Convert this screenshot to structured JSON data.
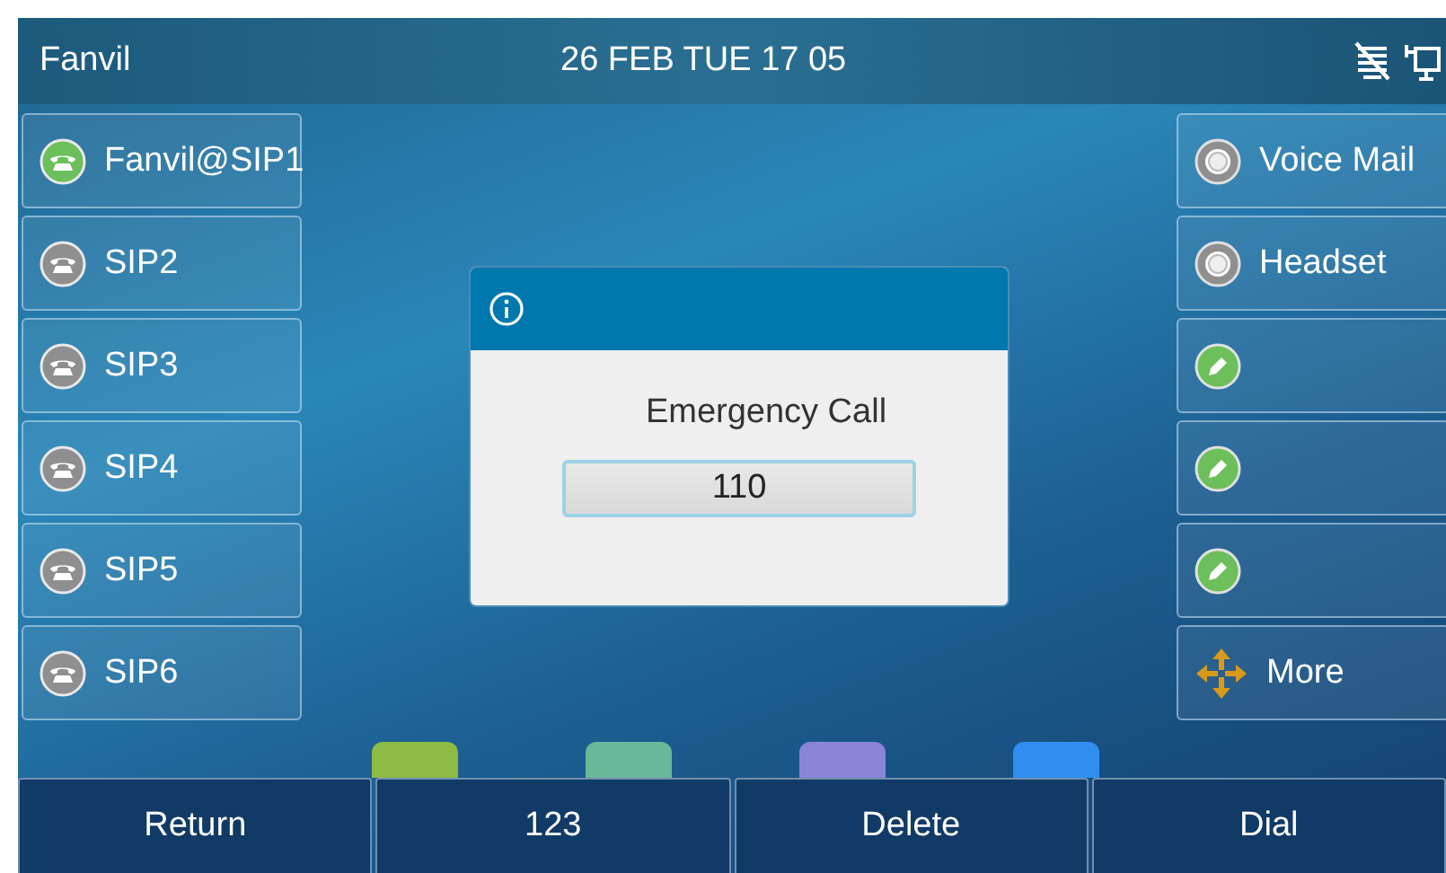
{
  "status_bar": {
    "title": "Fanvil",
    "datetime": "26 FEB TUE  17  05"
  },
  "line_keys": [
    {
      "label": "Fanvil@SIP1",
      "registered": true
    },
    {
      "label": "SIP2",
      "registered": false
    },
    {
      "label": "SIP3",
      "registered": false
    },
    {
      "label": "SIP4",
      "registered": false
    },
    {
      "label": "SIP5",
      "registered": false
    },
    {
      "label": "SIP6",
      "registered": false
    }
  ],
  "function_keys": [
    {
      "kind": "function",
      "label": "Voice Mail"
    },
    {
      "kind": "function",
      "label": "Headset"
    },
    {
      "kind": "dss"
    },
    {
      "kind": "dss"
    },
    {
      "kind": "dss"
    },
    {
      "kind": "more",
      "label": "More"
    }
  ],
  "dialog": {
    "message": "Emergency Call",
    "value": "110"
  },
  "softkeys": [
    "Return",
    "123",
    "Delete",
    "Dial"
  ]
}
